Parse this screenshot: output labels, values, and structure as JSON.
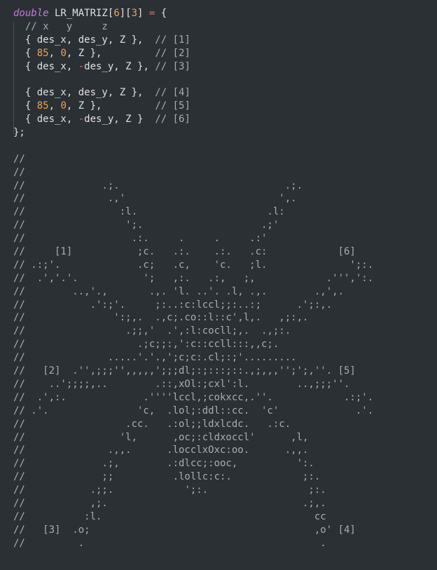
{
  "editor": {
    "colors": {
      "background": "#2b3035",
      "keyword": "#c678dd",
      "identifier": "#e0e0e0",
      "number": "#f0a24a",
      "operator": "#e06c75",
      "comment": "#a7adb5"
    },
    "lines": [
      [
        {
          "t": "kw",
          "v": "double"
        },
        {
          "t": "plain",
          "v": " LR_MATRIZ"
        },
        {
          "t": "punct",
          "v": "["
        },
        {
          "t": "num",
          "v": "6"
        },
        {
          "t": "punct",
          "v": "]["
        },
        {
          "t": "num",
          "v": "3"
        },
        {
          "t": "punct",
          "v": "] "
        },
        {
          "t": "op",
          "v": "="
        },
        {
          "t": "punct",
          "v": " {"
        }
      ],
      [
        {
          "t": "comment",
          "v": "  // x   y     z"
        }
      ],
      [
        {
          "t": "plain",
          "v": "  { des_x, des_y, Z },  "
        },
        {
          "t": "comment",
          "v": "// [1]"
        }
      ],
      [
        {
          "t": "plain",
          "v": "  { "
        },
        {
          "t": "num",
          "v": "85"
        },
        {
          "t": "plain",
          "v": ", "
        },
        {
          "t": "num",
          "v": "0"
        },
        {
          "t": "plain",
          "v": ", Z },         "
        },
        {
          "t": "comment",
          "v": "// [2]"
        }
      ],
      [
        {
          "t": "plain",
          "v": "  { des_x, "
        },
        {
          "t": "op",
          "v": "-"
        },
        {
          "t": "plain",
          "v": "des_y, Z }, "
        },
        {
          "t": "comment",
          "v": "// [3]"
        }
      ],
      [
        {
          "t": "plain",
          "v": ""
        }
      ],
      [
        {
          "t": "plain",
          "v": "  { des_x, des_y, Z },  "
        },
        {
          "t": "comment",
          "v": "// [4]"
        }
      ],
      [
        {
          "t": "plain",
          "v": "  { "
        },
        {
          "t": "num",
          "v": "85"
        },
        {
          "t": "plain",
          "v": ", "
        },
        {
          "t": "num",
          "v": "0"
        },
        {
          "t": "plain",
          "v": ", Z },         "
        },
        {
          "t": "comment",
          "v": "// [5]"
        }
      ],
      [
        {
          "t": "plain",
          "v": "  { des_x, "
        },
        {
          "t": "op",
          "v": "-"
        },
        {
          "t": "plain",
          "v": "des_y, Z }  "
        },
        {
          "t": "comment",
          "v": "// [6]"
        }
      ],
      [
        {
          "t": "punct",
          "v": "};"
        }
      ],
      [
        {
          "t": "plain",
          "v": ""
        }
      ],
      [
        {
          "t": "comment",
          "v": "//"
        }
      ],
      [
        {
          "t": "comment",
          "v": "//"
        }
      ],
      [
        {
          "t": "comment",
          "v": "//             .;.                            .;."
        }
      ],
      [
        {
          "t": "comment",
          "v": "//              .,'                          ',."
        }
      ],
      [
        {
          "t": "comment",
          "v": "//                :l.                      .l:"
        }
      ],
      [
        {
          "t": "comment",
          "v": "//                 ';.                    .;'"
        }
      ],
      [
        {
          "t": "comment",
          "v": "//                  .:.     .     .     .:'"
        }
      ],
      [
        {
          "t": "comment",
          "v": "//     [1]           ;c.   .:.    .:.   .c:            [6]"
        }
      ],
      [
        {
          "t": "comment",
          "v": "// .:;'.             .c;   .c,    'c.   ;l.              ';:."
        }
      ],
      [
        {
          "t": "comment",
          "v": "//  .','.'.           ';   ,:.   .:,   ;,            .''',':."
        }
      ],
      [
        {
          "t": "comment",
          "v": "//        ..,'.,       .,. 'l. ..'. .l, .,.        .,',."
        }
      ],
      [
        {
          "t": "comment",
          "v": "//           .':;'.     ;:..:c:lccl;;:..:;      .';:,."
        }
      ],
      [
        {
          "t": "comment",
          "v": "//               ':;,.  .,c;.co::l::c',l,.   ,;:,."
        }
      ],
      [
        {
          "t": "comment",
          "v": "//                 .;;,'  .',:l:cocll;,.  .,;:."
        }
      ],
      [
        {
          "t": "comment",
          "v": "//                   .;c;;:,':c::ccll:::,,c;."
        }
      ],
      [
        {
          "t": "comment",
          "v": "//              .....'.'.,';c;c:.cl;:;'........."
        }
      ],
      [
        {
          "t": "comment",
          "v": "//   [2]  .'',;;;'',,,,,';;;dl;:;:::;::.,;,,,'';';,''. [5]"
        }
      ],
      [
        {
          "t": "comment",
          "v": "//    ..';;;;,..        .::,xOl:;cxl':l.        ..,;;;''."
        }
      ],
      [
        {
          "t": "comment",
          "v": "//  .',:.             .''''lccl,;cokxcc,.''.            .:;'."
        }
      ],
      [
        {
          "t": "comment",
          "v": "// .'.               'c,  .lol;:ddl::cc.  'c'             .'."
        }
      ],
      [
        {
          "t": "comment",
          "v": "//                 .cc.   .:ol;;ldxlcdc.   .:c."
        }
      ],
      [
        {
          "t": "comment",
          "v": "//                'l,      ,oc;:cldxoccl'      ,l,"
        }
      ],
      [
        {
          "t": "comment",
          "v": "//              .,,.      .locclxOxc:oo.      .,,."
        }
      ],
      [
        {
          "t": "comment",
          "v": "//             .;,        .:dlcc;:ooc,          ':."
        }
      ],
      [
        {
          "t": "comment",
          "v": "//             ;;          .lollc:c:.            ;:."
        }
      ],
      [
        {
          "t": "comment",
          "v": "//           .;;.            ';:.                 ;:."
        }
      ],
      [
        {
          "t": "comment",
          "v": "//           ,;.                                 .;,."
        }
      ],
      [
        {
          "t": "comment",
          "v": "//          :l.                                    cc"
        }
      ],
      [
        {
          "t": "comment",
          "v": "//   [3]  .o;                                      ,o' [4]"
        }
      ],
      [
        {
          "t": "comment",
          "v": "//         .                                        ."
        }
      ]
    ]
  }
}
